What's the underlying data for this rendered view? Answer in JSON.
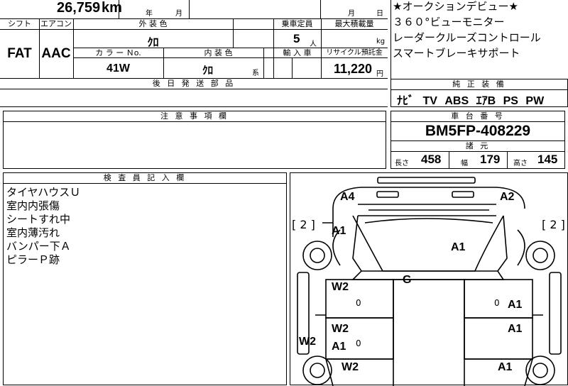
{
  "top_row": {
    "mileage": "26,759",
    "mileage_unit": "km",
    "year_label": "年",
    "month_label": "月",
    "month_label2": "月",
    "day_label": "日"
  },
  "spec_headers": {
    "shift": "シフト",
    "aircon": "エアコン",
    "exterior_color": "外 装 色",
    "capacity": "乗車定員",
    "max_load": "最大積載量",
    "color_no": "カ ラ ー Ｎo.",
    "interior_color": "内 装 色",
    "import": "輸 入 車",
    "recycle": "リサイクル預託金"
  },
  "spec_values": {
    "shift": "FAT",
    "aircon": "AAC",
    "exterior_color": "ｸﾛ",
    "capacity": "5",
    "capacity_unit": "人",
    "max_load_unit": "kg",
    "color_no": "41W",
    "interior_color": "ｸﾛ",
    "interior_suffix": "系",
    "recycle": "11,220",
    "recycle_unit": "円"
  },
  "later_parts": {
    "header": "後 日 発 送 部 品"
  },
  "notes_section": {
    "header": "注 意 事 項 欄"
  },
  "inspector": {
    "header": "検 査 員 記 入 欄",
    "lines": [
      "タイヤハウスＵ",
      "室内内張傷",
      "シートすれ中",
      "室内薄汚れ",
      "バンパー下Ａ",
      "ピラーＰ跡"
    ]
  },
  "features": {
    "lines": [
      "★オークションデビュー★",
      "３６０°ビューモニター",
      "レーダークルーズコントロール",
      "スマートブレーキサポート"
    ]
  },
  "genuine_equipment": {
    "header": "純 正 装 備",
    "items": [
      "ﾅﾋﾞ",
      "TV",
      "ABS",
      "ｴｱB",
      "PS",
      "PW"
    ]
  },
  "chassis": {
    "header": "車 台 番 号",
    "number": "BM5FP-408229"
  },
  "dimensions": {
    "header": "諸 元",
    "length_label": "長さ",
    "length": "458",
    "width_label": "幅",
    "width": "179",
    "height_label": "高さ",
    "height": "145"
  },
  "diagram": {
    "left_bracket": "[ 2 ]",
    "right_bracket": "[ 2 ]",
    "marks": {
      "front_left": "A4",
      "front_right": "A2",
      "left_fender": "A1",
      "hood": "A1",
      "roof": "G",
      "left_front_door": "W2",
      "right_front_door": "A1",
      "left_rear_door": "W2",
      "left_rear_door_2": "A1",
      "right_rear_door": "A1",
      "left_sill": "W2",
      "left_quarter": "W2",
      "right_quarter": "A1",
      "small_0_a": "0",
      "small_0_b": "0",
      "small_0_c": "0"
    }
  }
}
